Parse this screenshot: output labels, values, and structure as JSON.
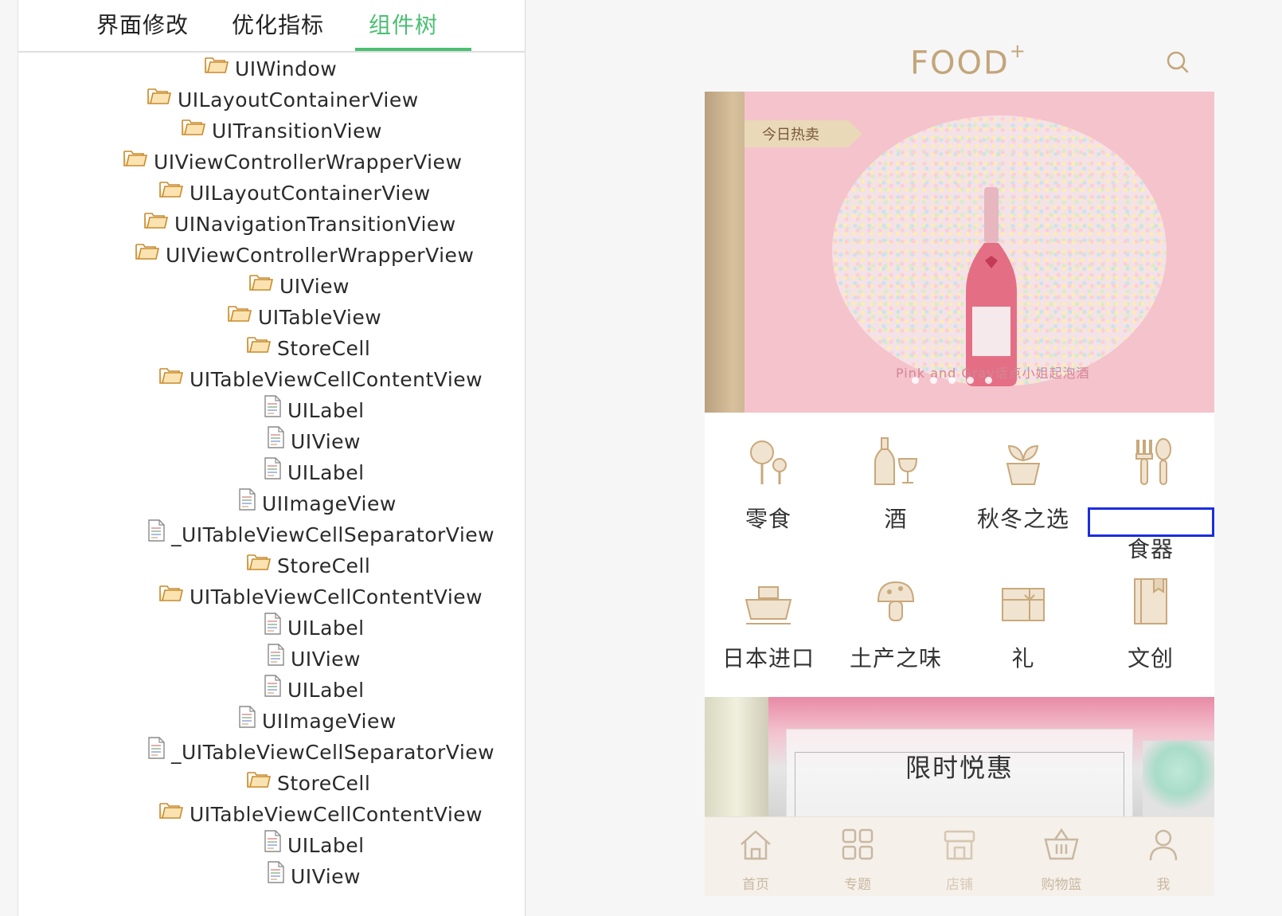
{
  "inspector": {
    "tabs": [
      {
        "label": "界面修改"
      },
      {
        "label": "优化指标"
      },
      {
        "label": "组件树",
        "active": true
      }
    ],
    "tree": [
      {
        "label": "UIWindow",
        "type": "folder"
      },
      {
        "label": "UILayoutContainerView",
        "type": "folder"
      },
      {
        "label": "UITransitionView",
        "type": "folder"
      },
      {
        "label": "UIViewControllerWrapperView",
        "type": "folder"
      },
      {
        "label": "UILayoutContainerView",
        "type": "folder"
      },
      {
        "label": "UINavigationTransitionView",
        "type": "folder"
      },
      {
        "label": "UIViewControllerWrapperView",
        "type": "folder"
      },
      {
        "label": "UIView",
        "type": "folder"
      },
      {
        "label": "UITableView",
        "type": "folder"
      },
      {
        "label": "StoreCell",
        "type": "folder"
      },
      {
        "label": "UITableViewCellContentView",
        "type": "folder"
      },
      {
        "label": "UILabel",
        "type": "file"
      },
      {
        "label": "UIView",
        "type": "file"
      },
      {
        "label": "UILabel",
        "type": "file"
      },
      {
        "label": "UIImageView",
        "type": "file"
      },
      {
        "label": "_UITableViewCellSeparatorView",
        "type": "file"
      },
      {
        "label": "StoreCell",
        "type": "folder"
      },
      {
        "label": "UITableViewCellContentView",
        "type": "folder"
      },
      {
        "label": "UILabel",
        "type": "file"
      },
      {
        "label": "UIView",
        "type": "file"
      },
      {
        "label": "UILabel",
        "type": "file"
      },
      {
        "label": "UIImageView",
        "type": "file"
      },
      {
        "label": "_UITableViewCellSeparatorView",
        "type": "file"
      },
      {
        "label": "StoreCell",
        "type": "folder"
      },
      {
        "label": "UITableViewCellContentView",
        "type": "folder"
      },
      {
        "label": "UILabel",
        "type": "file"
      },
      {
        "label": "UIView",
        "type": "file"
      }
    ]
  },
  "app": {
    "logo": "FOOD",
    "logo_mark": "+",
    "banner": {
      "tag": "今日热卖",
      "caption": "Pink and Gray话点小姐起泡酒"
    },
    "categories": [
      {
        "label": "零食",
        "icon": "lollipop-icon"
      },
      {
        "label": "酒",
        "icon": "wine-icon"
      },
      {
        "label": "秋冬之选",
        "icon": "plant-icon"
      },
      {
        "label": "食器",
        "icon": "cutlery-icon"
      },
      {
        "label": "日本进口",
        "icon": "ship-icon"
      },
      {
        "label": "土产之味",
        "icon": "mushroom-icon"
      },
      {
        "label": "礼",
        "icon": "gift-icon"
      },
      {
        "label": "文创",
        "icon": "book-icon"
      }
    ],
    "promo_title": "限时悦惠",
    "tabbar": [
      {
        "label": "首页",
        "icon": "home-icon"
      },
      {
        "label": "专题",
        "icon": "grid-icon"
      },
      {
        "label": "店铺",
        "icon": "store-icon"
      },
      {
        "label": "购物篮",
        "icon": "basket-icon"
      },
      {
        "label": "我",
        "icon": "user-icon"
      }
    ],
    "colors": {
      "accent": "#4bbf73",
      "gold": "#c3a57a",
      "highlight": "#1b2ee0"
    }
  }
}
